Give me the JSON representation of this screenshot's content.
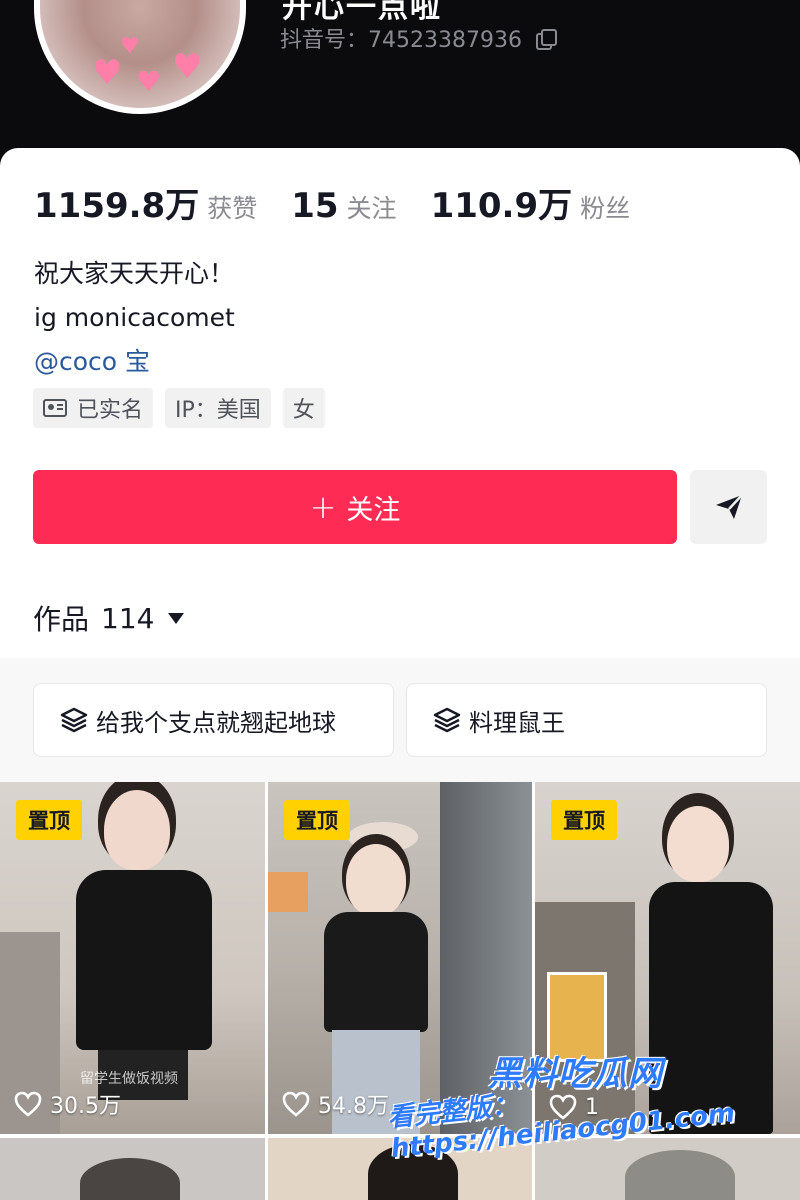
{
  "profile": {
    "name_partial": "开心一点啦",
    "douyin_id": "抖音号：74523387936",
    "stats": [
      {
        "num": "1159.8万",
        "label": "获赞"
      },
      {
        "num": "15",
        "label": "关注"
      },
      {
        "num": "110.9万",
        "label": "粉丝"
      }
    ],
    "bio": [
      "祝大家天天开心！",
      "ig monicacomet"
    ],
    "mention": "@coco 宝",
    "tags": {
      "verified": "已实名",
      "ip": "IP：美国",
      "gender": "女"
    }
  },
  "actions": {
    "follow_plus": "+",
    "follow_label": "关注"
  },
  "works": {
    "label": "作品",
    "count": "114"
  },
  "collections": [
    {
      "label": "给我个支点就翘起地球"
    },
    {
      "label": "料理鼠王"
    }
  ],
  "videos": [
    {
      "pinned": "置顶",
      "likes": "30.5万",
      "caption": "留学生做饭视频"
    },
    {
      "pinned": "置顶",
      "likes": "54.8万",
      "caption": ""
    },
    {
      "pinned": "置顶",
      "likes": "1",
      "caption": ""
    }
  ],
  "watermark": {
    "line1": "黑料吃瓜网",
    "line2": "看完整版：https://heiliaocg01.com"
  },
  "colors": {
    "follow_red": "#fe2c55",
    "pin_yellow": "#ffd100",
    "link_blue": "#2b5a9c"
  }
}
